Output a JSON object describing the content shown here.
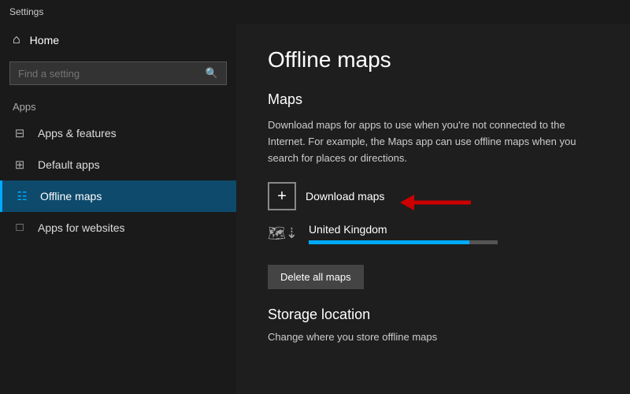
{
  "titleBar": {
    "label": "Settings"
  },
  "sidebar": {
    "homeLabel": "Home",
    "searchPlaceholder": "Find a setting",
    "sectionLabel": "Apps",
    "navItems": [
      {
        "id": "apps-features",
        "label": "Apps & features",
        "icon": "☰",
        "active": false
      },
      {
        "id": "default-apps",
        "label": "Default apps",
        "icon": "⊞",
        "active": false
      },
      {
        "id": "offline-maps",
        "label": "Offline maps",
        "icon": "⊞",
        "active": true
      },
      {
        "id": "apps-websites",
        "label": "Apps for websites",
        "icon": "⊡",
        "active": false
      }
    ]
  },
  "content": {
    "pageTitle": "Offline maps",
    "sectionTitle": "Maps",
    "description": "Download maps for apps to use when you're not connected to the Internet. For example, the Maps app can use offline maps when you search for places or directions.",
    "downloadMapsLabel": "Download maps",
    "mapItem": {
      "name": "United Kingdom",
      "progressPercent": 85
    },
    "deleteButtonLabel": "Delete all maps",
    "storageSectionTitle": "Storage location",
    "storageDescription": "Change where you store offline maps"
  }
}
